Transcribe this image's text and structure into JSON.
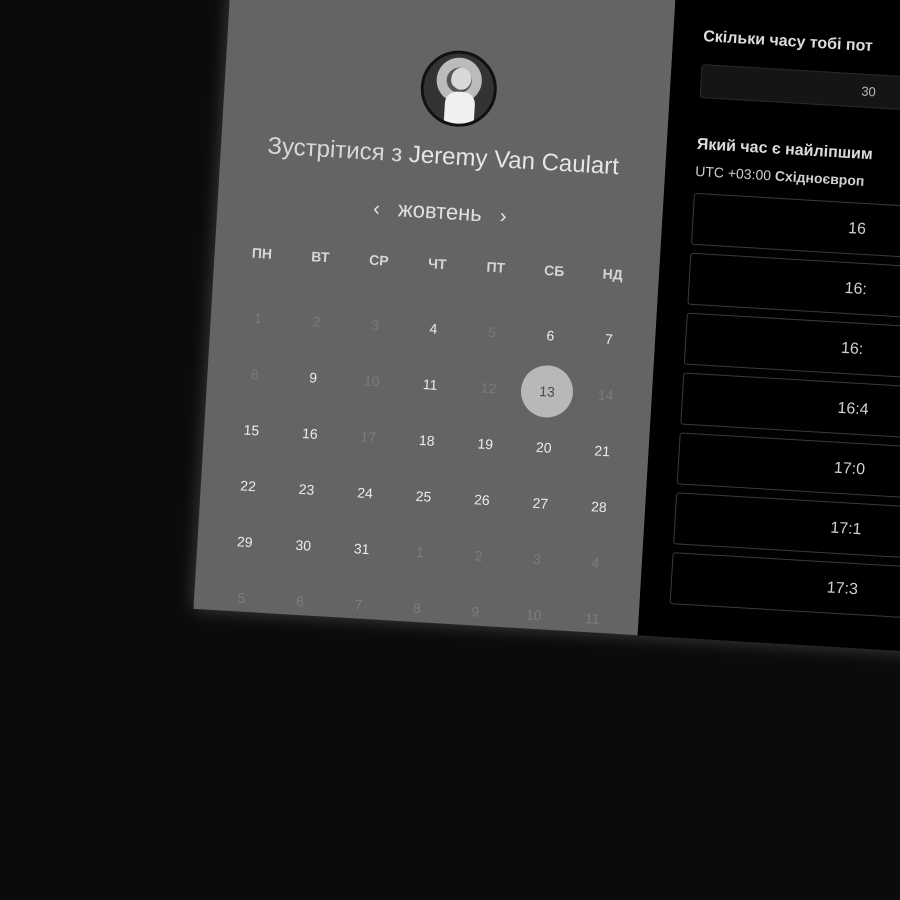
{
  "organizer": {
    "meet_prefix": "Зустрітися з",
    "name": "Jeremy Van Caulart"
  },
  "calendar": {
    "month": "жовтень",
    "prev_icon": "‹",
    "next_icon": "›",
    "weekdays": [
      "ПН",
      "ВТ",
      "СР",
      "ЧТ",
      "ПТ",
      "СБ",
      "НД"
    ],
    "days": [
      {
        "label": "1",
        "state": "muted"
      },
      {
        "label": "2",
        "state": "muted"
      },
      {
        "label": "3",
        "state": "muted"
      },
      {
        "label": "4",
        "state": "available"
      },
      {
        "label": "5",
        "state": "muted"
      },
      {
        "label": "6",
        "state": "available"
      },
      {
        "label": "7",
        "state": "available"
      },
      {
        "label": "8",
        "state": "muted"
      },
      {
        "label": "9",
        "state": "available"
      },
      {
        "label": "10",
        "state": "muted"
      },
      {
        "label": "11",
        "state": "available"
      },
      {
        "label": "12",
        "state": "muted"
      },
      {
        "label": "13",
        "state": "selected"
      },
      {
        "label": "14",
        "state": "muted"
      },
      {
        "label": "15",
        "state": "available"
      },
      {
        "label": "16",
        "state": "available"
      },
      {
        "label": "17",
        "state": "muted"
      },
      {
        "label": "18",
        "state": "available"
      },
      {
        "label": "19",
        "state": "available"
      },
      {
        "label": "20",
        "state": "available"
      },
      {
        "label": "21",
        "state": "available"
      },
      {
        "label": "22",
        "state": "available"
      },
      {
        "label": "23",
        "state": "available"
      },
      {
        "label": "24",
        "state": "available"
      },
      {
        "label": "25",
        "state": "available"
      },
      {
        "label": "26",
        "state": "available"
      },
      {
        "label": "27",
        "state": "available"
      },
      {
        "label": "28",
        "state": "available"
      },
      {
        "label": "29",
        "state": "available"
      },
      {
        "label": "30",
        "state": "available"
      },
      {
        "label": "31",
        "state": "available"
      },
      {
        "label": "1",
        "state": "other"
      },
      {
        "label": "2",
        "state": "other"
      },
      {
        "label": "3",
        "state": "other"
      },
      {
        "label": "4",
        "state": "other"
      },
      {
        "label": "5",
        "state": "other"
      },
      {
        "label": "6",
        "state": "other"
      },
      {
        "label": "7",
        "state": "other"
      },
      {
        "label": "8",
        "state": "other"
      },
      {
        "label": "9",
        "state": "other"
      },
      {
        "label": "10",
        "state": "other"
      },
      {
        "label": "11",
        "state": "other"
      }
    ]
  },
  "duration": {
    "title": "Скільки часу тобі пот",
    "value": "30"
  },
  "timeslots": {
    "title": "Який час є найліпшим",
    "tz_offset": "UTC +03:00",
    "tz_name": "Східноєвроп",
    "slots": [
      "16",
      "16:",
      "16:",
      "16:4",
      "17:0",
      "17:1",
      "17:3"
    ]
  },
  "colors": {
    "left_panel": "#646464",
    "right_panel": "#000000",
    "selected_day": "#b8b8b8",
    "background": "#0b0b0b"
  }
}
